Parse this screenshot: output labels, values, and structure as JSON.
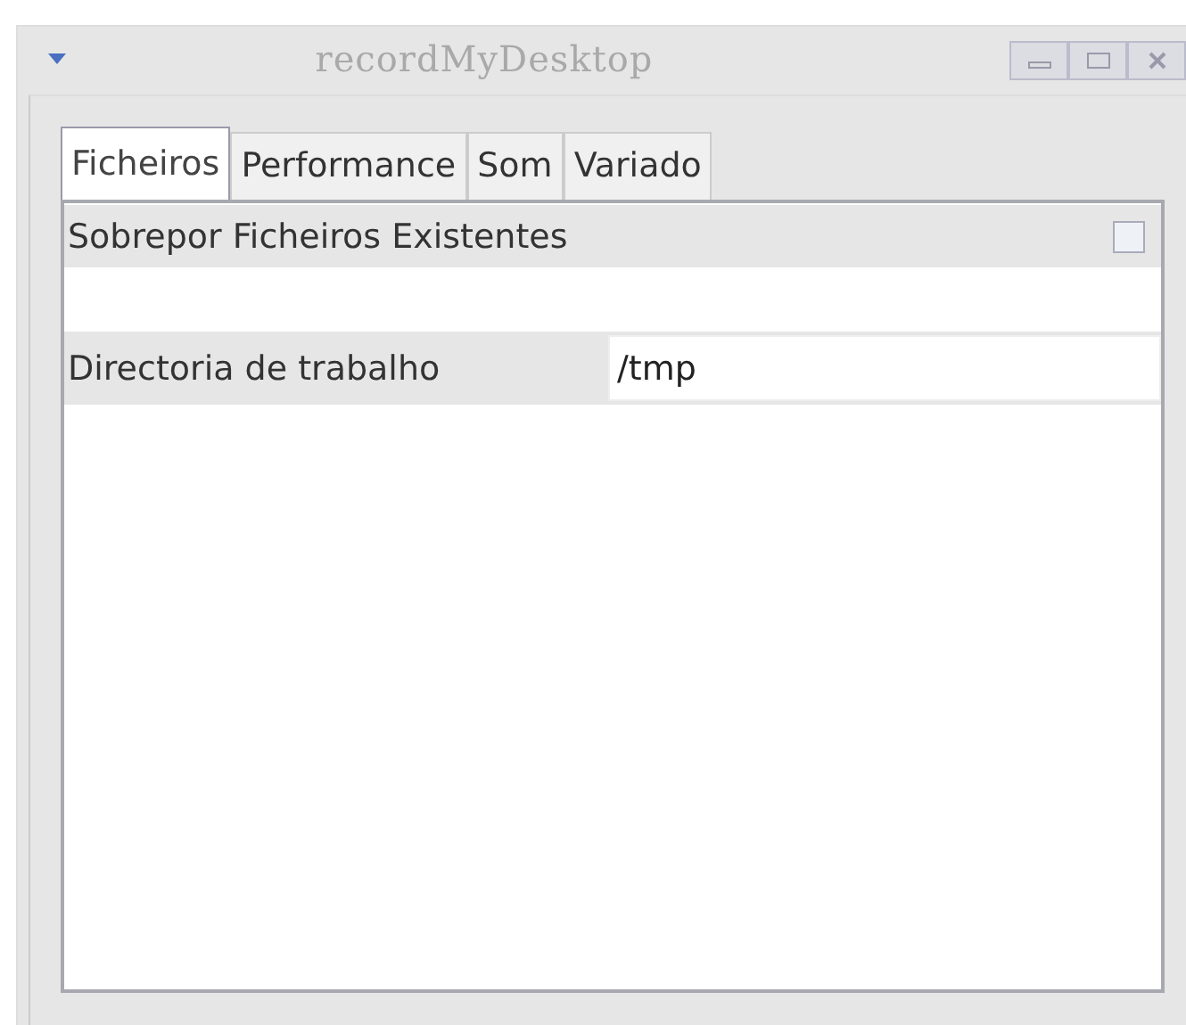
{
  "window": {
    "title": "recordMyDesktop"
  },
  "tabs": [
    {
      "label": "Ficheiros",
      "selected": true
    },
    {
      "label": "Performance",
      "selected": false
    },
    {
      "label": "Som",
      "selected": false
    },
    {
      "label": "Variado",
      "selected": false
    }
  ],
  "settings": [
    {
      "kind": "checkbox",
      "label": "Sobrepor Ficheiros Existentes",
      "checked": false
    },
    {
      "kind": "text",
      "label": "Directoria de trabalho",
      "value": "/tmp"
    }
  ]
}
